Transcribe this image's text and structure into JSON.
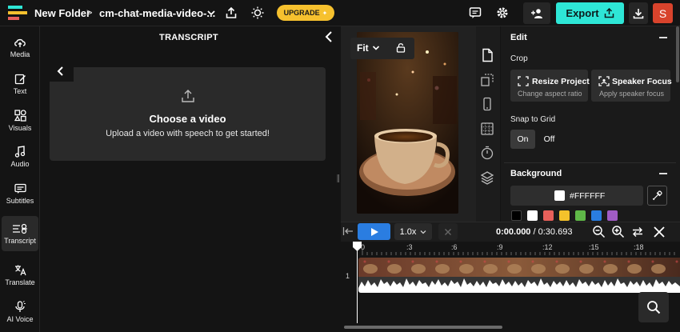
{
  "topbar": {
    "folder": "New Folder",
    "separator": ">",
    "project": "cm-chat-media-video-...",
    "upgrade_label": "UPGRADE",
    "export_label": "Export",
    "avatar_initial": "S",
    "icons": [
      "logo-icon",
      "share-icon",
      "bulb-icon",
      "chat-icon",
      "gear-icon",
      "add-user-icon",
      "download-icon"
    ]
  },
  "nav": {
    "items": [
      {
        "label": "Media",
        "icon": "cloud-upload-icon"
      },
      {
        "label": "Text",
        "icon": "text-edit-icon"
      },
      {
        "label": "Visuals",
        "icon": "shapes-icon"
      },
      {
        "label": "Audio",
        "icon": "music-note-icon"
      },
      {
        "label": "Subtitles",
        "icon": "subtitles-icon"
      },
      {
        "label": "Transcript",
        "icon": "transcript-icon"
      },
      {
        "label": "Translate",
        "icon": "translate-icon"
      },
      {
        "label": "AI Voice",
        "icon": "microphone-icon"
      }
    ],
    "active": "Transcript"
  },
  "transcript": {
    "title": "TRANSCRIPT",
    "card_title": "Choose a video",
    "card_subtitle": "Upload a video with speech to get started!"
  },
  "preview": {
    "fit_label": "Fit"
  },
  "edit": {
    "title": "Edit",
    "crop_label": "Crop",
    "resize_title": "Resize Project",
    "resize_sub": "Change aspect ratio",
    "speaker_title": "Speaker Focus",
    "speaker_sub": "Apply speaker focus",
    "snap_label": "Snap to Grid",
    "on_label": "On",
    "off_label": "Off",
    "background_label": "Background",
    "background_hex": "#FFFFFF",
    "swatches": [
      "#000000",
      "#ffffff",
      "#e8605a",
      "#f4c22b",
      "#5fb848",
      "#2a7de1",
      "#a05cc4"
    ]
  },
  "timeline": {
    "speed": "1.0x",
    "current_time": "0:00.000",
    "total_time": "/ 0:30.693",
    "ticks": [
      "0",
      ":3",
      ":6",
      ":9",
      ":12",
      ":15",
      ":18"
    ],
    "track_number": "1"
  },
  "colors": {
    "accent": "#2ee6d6",
    "play": "#2a7de1",
    "upgrade": "#f6c12e",
    "avatar": "#d8432c"
  }
}
